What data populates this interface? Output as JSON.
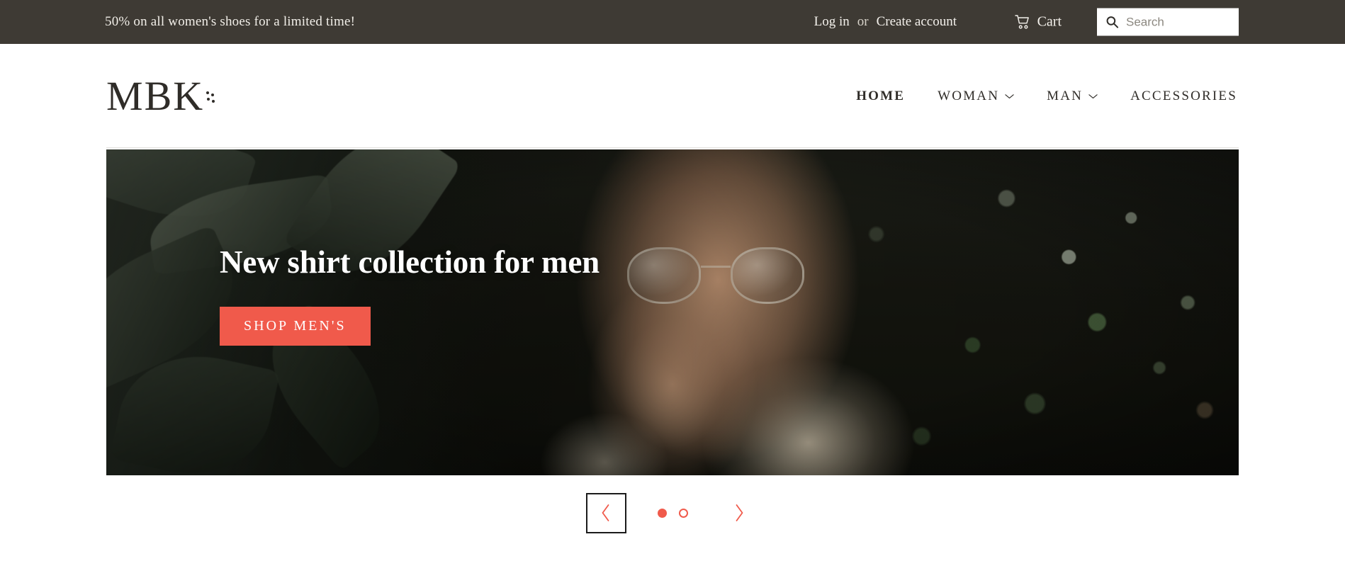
{
  "announcement": {
    "text": "50% on all women's shoes for a limited time!",
    "background": "#3e3a34"
  },
  "topbar": {
    "login_label": "Log in",
    "or_label": "or",
    "create_account_label": "Create account",
    "cart_label": "Cart",
    "cart_icon": "shopping-cart-icon",
    "search_icon": "search-icon",
    "search_value": "",
    "search_placeholder": "Search"
  },
  "header": {
    "logo_text": "MBK",
    "nav": [
      {
        "label": "HOME",
        "active": true,
        "has_dropdown": false
      },
      {
        "label": "WOMAN",
        "active": false,
        "has_dropdown": true
      },
      {
        "label": "MAN",
        "active": false,
        "has_dropdown": true
      },
      {
        "label": "ACCESSORIES",
        "active": false,
        "has_dropdown": false
      }
    ]
  },
  "hero": {
    "title": "New shirt collection for men",
    "cta_label": "SHOP MEN'S",
    "cta_color": "#f05a4b"
  },
  "carousel": {
    "prev_label": "Previous slide",
    "next_label": "Next slide",
    "prev_icon": "chevron-left-icon",
    "next_icon": "chevron-right-icon",
    "slides": [
      {
        "label": "Slide 1",
        "active": true
      },
      {
        "label": "Slide 2",
        "active": false
      }
    ],
    "accent": "#f05a4b"
  }
}
